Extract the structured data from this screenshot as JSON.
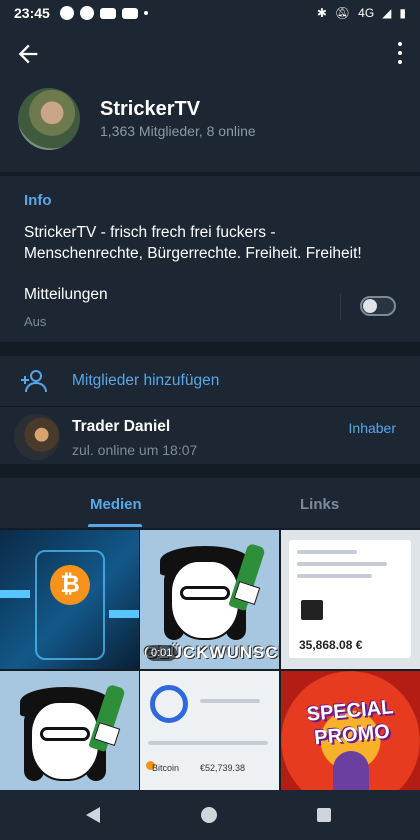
{
  "status_bar": {
    "time": "23:45",
    "network": "4G",
    "icons": [
      "spotify-icon",
      "messenger-icon",
      "youtube-icon",
      "youtube-icon",
      "bluetooth-icon",
      "mute-icon",
      "signal-icon",
      "battery-icon"
    ]
  },
  "header": {
    "channel_name": "StrickerTV",
    "subtitle": "1,363 Mitglieder, 8 online"
  },
  "info": {
    "title": "Info",
    "description": "StrickerTV - frisch frech frei fuckers - Menschenrechte, Bürgerrechte. Freiheit. Freiheit!",
    "notifications_label": "Mitteilungen",
    "notifications_value": "Aus"
  },
  "members": {
    "add_label": "Mitglieder hinzufügen",
    "list": [
      {
        "name": "Trader Daniel",
        "status": "zul. online um 18:07",
        "role": "Inhaber"
      }
    ]
  },
  "tabs": {
    "media": "Medien",
    "links": "Links"
  },
  "media": {
    "gif_caption": "GLÜCKWUNSCH!",
    "duration": "0:01",
    "screenshot_amount": "35,868.08 €",
    "bitcoin_label": "Bitcoin",
    "bitcoin_value": "€52,739.38",
    "promo_text": "SPECIAL PROMO"
  },
  "colors": {
    "accent": "#5aa7e6",
    "background": "#1d2733",
    "section_gap": "#131b24",
    "secondary_text": "#7d8b99"
  }
}
